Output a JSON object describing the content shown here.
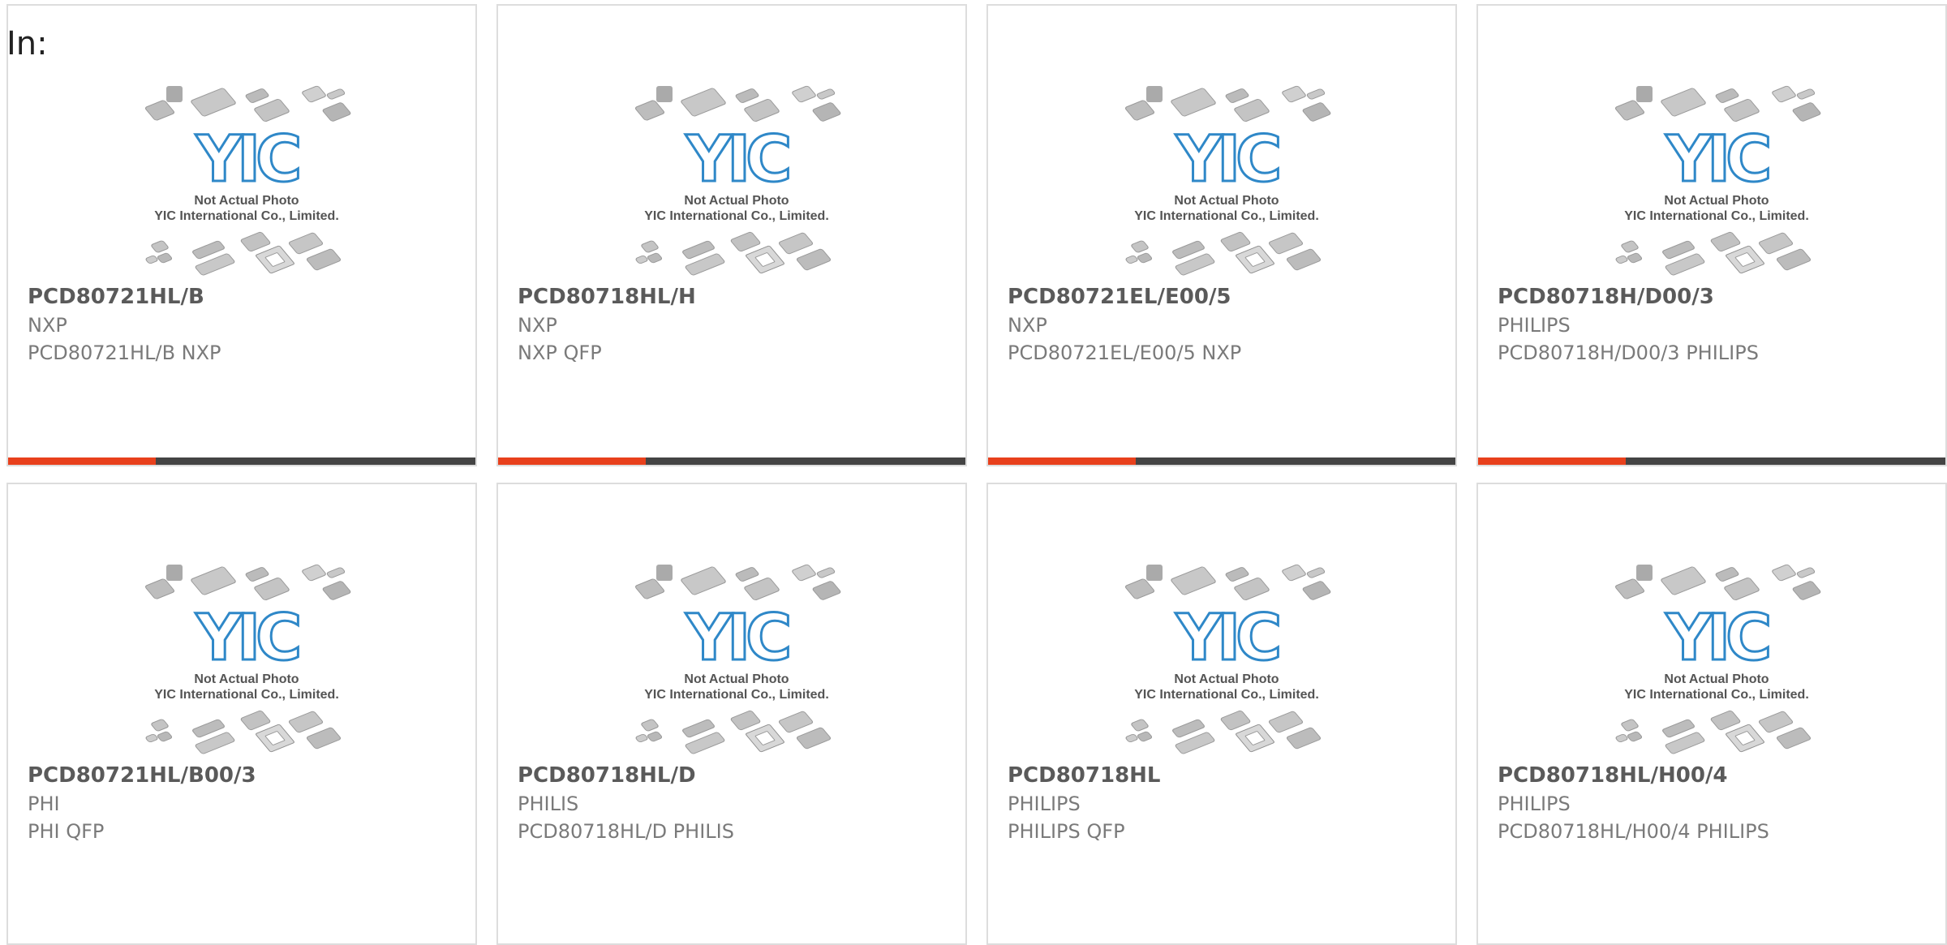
{
  "page": {
    "label": "In:"
  },
  "colors": {
    "accent": "#e8401c",
    "bar": "#444444",
    "logo": "#2f88c8"
  },
  "placeholder": {
    "line1": "Not Actual Photo",
    "line2": "YIC International Co., Limited.",
    "logo_text": "YIC"
  },
  "products": [
    {
      "part": "PCD80721HL/B",
      "brand": "NXP",
      "desc": "PCD80721HL/B NXP"
    },
    {
      "part": "PCD80718HL/H",
      "brand": "NXP",
      "desc": "NXP QFP"
    },
    {
      "part": "PCD80721EL/E00/5",
      "brand": "NXP",
      "desc": "PCD80721EL/E00/5 NXP"
    },
    {
      "part": "PCD80718H/D00/3",
      "brand": "PHILIPS",
      "desc": "PCD80718H/D00/3 PHILIPS"
    },
    {
      "part": "PCD80721HL/B00/3",
      "brand": "PHI",
      "desc": "PHI QFP"
    },
    {
      "part": "PCD80718HL/D",
      "brand": "PHILIS",
      "desc": "PCD80718HL/D PHILIS"
    },
    {
      "part": "PCD80718HL",
      "brand": "PHILIPS",
      "desc": "PHILIPS QFP"
    },
    {
      "part": "PCD80718HL/H00/4",
      "brand": "PHILIPS",
      "desc": "PCD80718HL/H00/4 PHILIPS"
    }
  ]
}
